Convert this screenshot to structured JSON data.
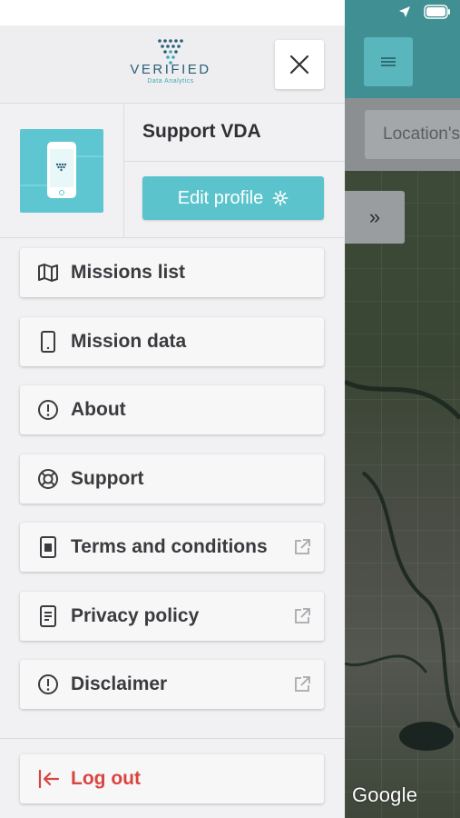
{
  "drawer": {
    "logo_word": "VERIFIED",
    "logo_sub": "Data Analytics",
    "profile_name": "Support VDA",
    "edit_profile_label": "Edit profile",
    "menu": [
      {
        "label": "Missions list",
        "icon": "map-icon",
        "external": false
      },
      {
        "label": "Mission data",
        "icon": "phone-icon",
        "external": false
      },
      {
        "label": "About",
        "icon": "info-circle-icon",
        "external": false
      },
      {
        "label": "Support",
        "icon": "lifebuoy-icon",
        "external": false
      },
      {
        "label": "Terms and conditions",
        "icon": "document-icon",
        "external": true
      },
      {
        "label": "Privacy policy",
        "icon": "list-document-icon",
        "external": true
      },
      {
        "label": "Disclaimer",
        "icon": "info-circle-icon",
        "external": true
      }
    ],
    "logout_label": "Log out"
  },
  "background": {
    "search_placeholder": "Location's",
    "map_attribution": "Google",
    "expand_symbol": "»"
  },
  "colors": {
    "accent": "#5bc3cc",
    "header_teal": "#3f8f93",
    "logout_red": "#d9443f"
  }
}
